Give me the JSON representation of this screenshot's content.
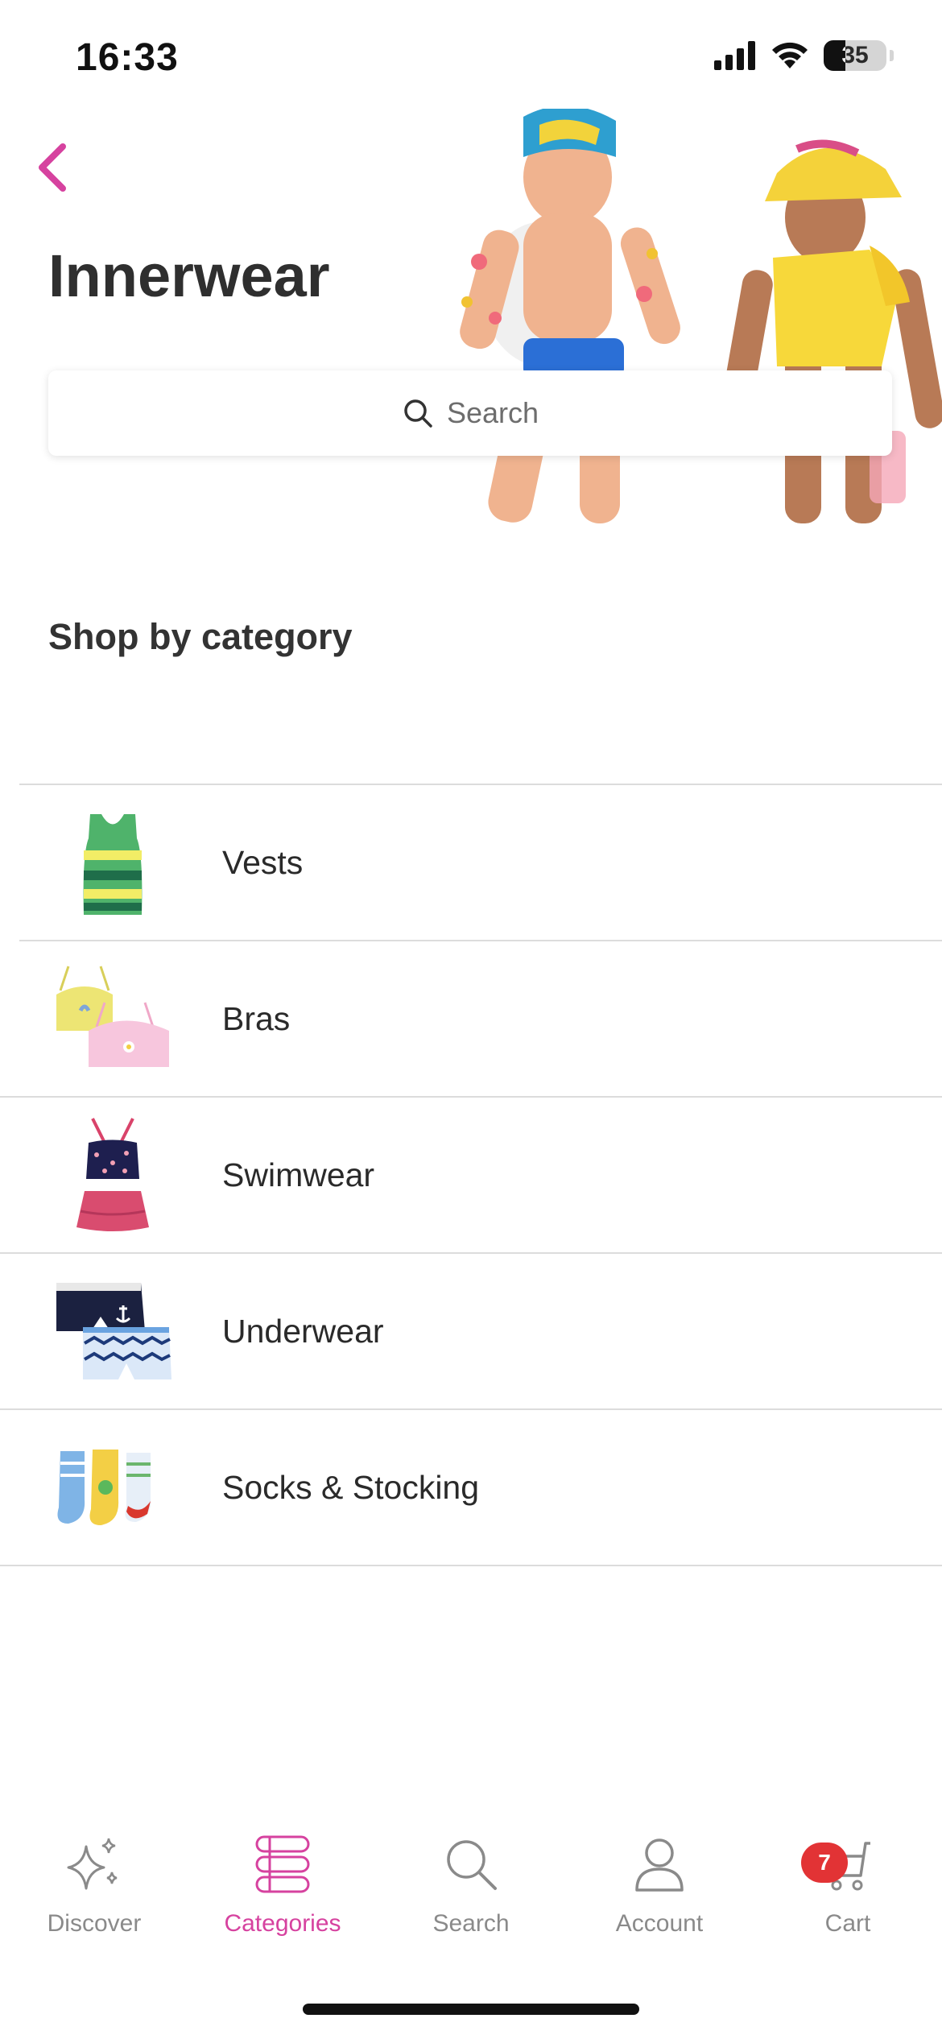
{
  "status_bar": {
    "time": "16:33",
    "battery": "35"
  },
  "header": {
    "title": "Innerwear"
  },
  "search": {
    "placeholder": "Search"
  },
  "section": {
    "title": "Shop by category"
  },
  "categories": [
    {
      "label": "Vests"
    },
    {
      "label": "Bras"
    },
    {
      "label": "Swimwear"
    },
    {
      "label": "Underwear"
    },
    {
      "label": "Socks & Stocking"
    }
  ],
  "bottom_nav": {
    "items": [
      {
        "label": "Discover",
        "icon": "sparkle-icon"
      },
      {
        "label": "Categories",
        "icon": "categories-icon",
        "active": true
      },
      {
        "label": "Search",
        "icon": "search-icon"
      },
      {
        "label": "Account",
        "icon": "account-icon"
      },
      {
        "label": "Cart",
        "icon": "cart-icon",
        "badge": "7"
      }
    ]
  },
  "colors": {
    "accent": "#d6429f",
    "badge": "#e23335"
  }
}
